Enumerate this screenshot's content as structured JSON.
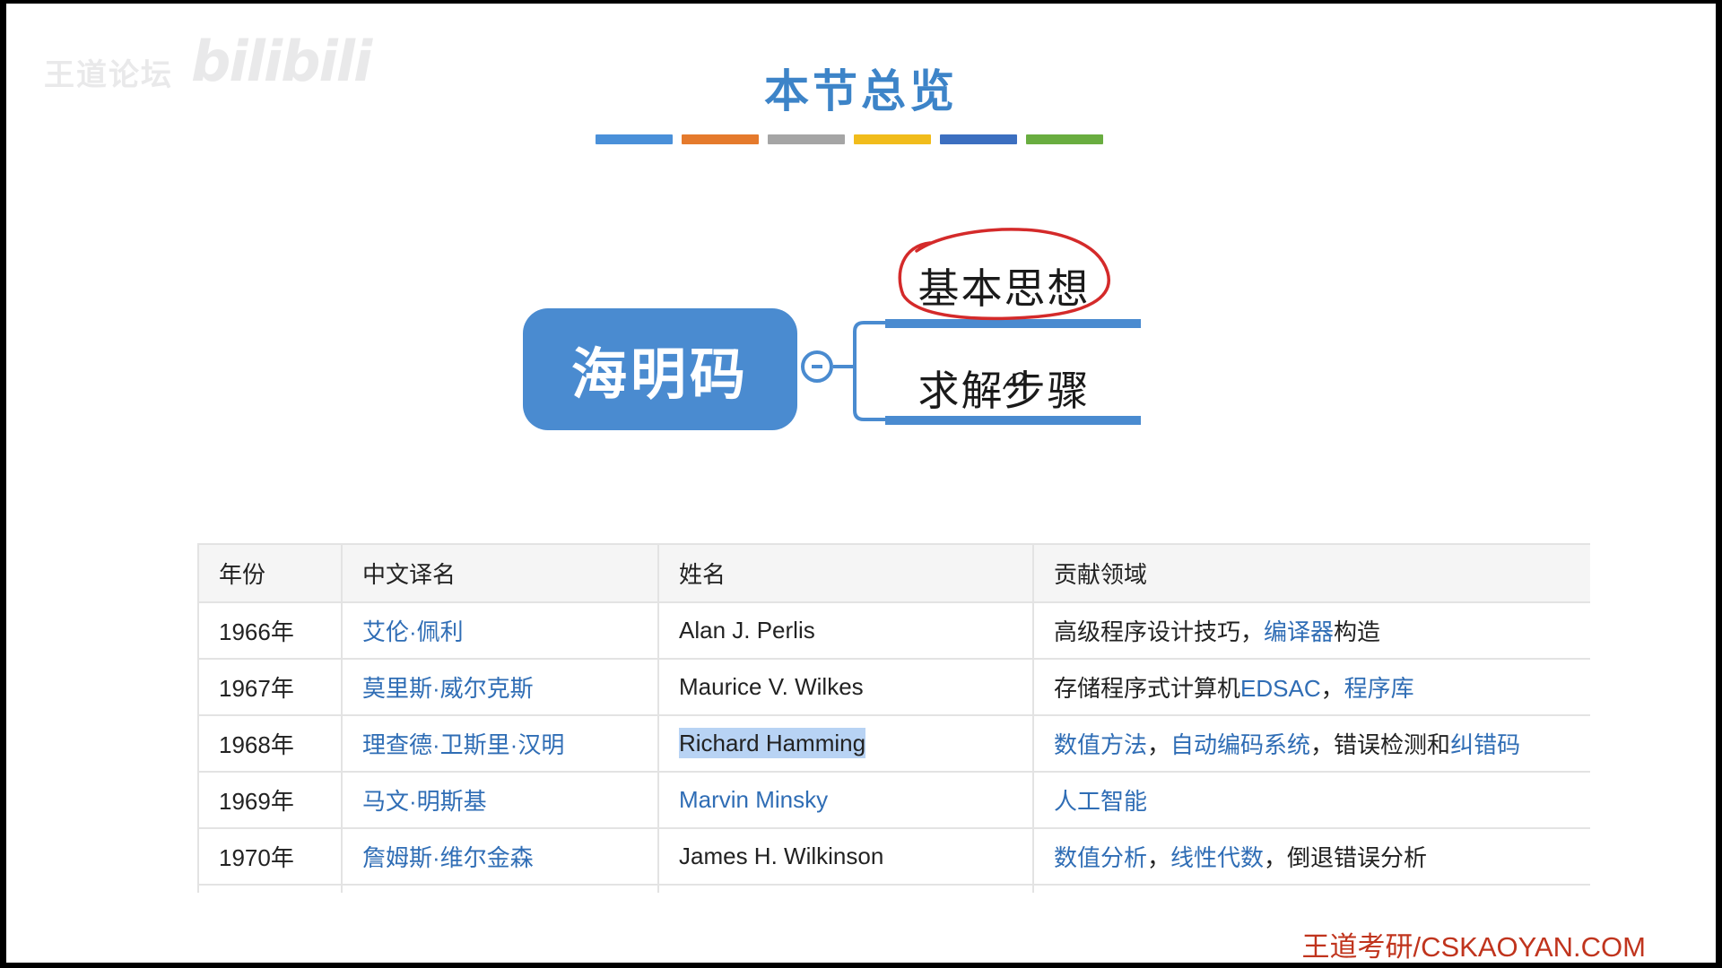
{
  "watermark": {
    "text": "王道论坛",
    "logo": "bilibili"
  },
  "title": "本节总览",
  "colors": {
    "title": "#3d84c8",
    "root_fill": "#4a8bd0",
    "branch_line": "#4a8bd0",
    "circle_annotation": "#d42a2a",
    "link": "#2f6db5",
    "footer": "#c0341d"
  },
  "color_bar": [
    "#4a90d9",
    "#e57a2c",
    "#a5a5a5",
    "#f1bc1b",
    "#3c6fc0",
    "#69ad40"
  ],
  "mindmap": {
    "root": "海明码",
    "branches": [
      "基本思想",
      "求解步骤"
    ]
  },
  "table": {
    "headers": [
      "年份",
      "中文译名",
      "姓名",
      "贡献领域"
    ],
    "rows": [
      {
        "year": "1966年",
        "cn": "艾伦·佩利",
        "en": "Alan J. Perlis",
        "en_link": false,
        "en_highlight": false,
        "field": [
          {
            "t": "高级程序设计技巧，",
            "link": false
          },
          {
            "t": "编译器",
            "link": true
          },
          {
            "t": "构造",
            "link": false
          }
        ]
      },
      {
        "year": "1967年",
        "cn": "莫里斯·威尔克斯",
        "en": "Maurice V. Wilkes",
        "en_link": false,
        "en_highlight": false,
        "field": [
          {
            "t": "存储程序式计算机",
            "link": false
          },
          {
            "t": "EDSAC",
            "link": true
          },
          {
            "t": "，",
            "link": false
          },
          {
            "t": "程序库",
            "link": true
          }
        ]
      },
      {
        "year": "1968年",
        "cn": "理查德·卫斯里·汉明",
        "en": "Richard Hamming",
        "en_link": false,
        "en_highlight": true,
        "field": [
          {
            "t": "数值方法",
            "link": true
          },
          {
            "t": "，",
            "link": false
          },
          {
            "t": "自动编码系统",
            "link": true
          },
          {
            "t": "，错误检测和",
            "link": false
          },
          {
            "t": "纠错码",
            "link": true
          }
        ]
      },
      {
        "year": "1969年",
        "cn": "马文·明斯基",
        "en": "Marvin Minsky",
        "en_link": true,
        "en_highlight": false,
        "field": [
          {
            "t": "人工智能",
            "link": true
          }
        ]
      },
      {
        "year": "1970年",
        "cn": "詹姆斯·维尔金森",
        "en": "James H. Wilkinson",
        "en_link": false,
        "en_highlight": false,
        "field": [
          {
            "t": "数值分析",
            "link": true
          },
          {
            "t": "，",
            "link": false
          },
          {
            "t": "线性代数",
            "link": true
          },
          {
            "t": "，倒退错误分析",
            "link": false
          }
        ]
      }
    ]
  },
  "footer": "王道考研/CSKAOYAN.COM"
}
